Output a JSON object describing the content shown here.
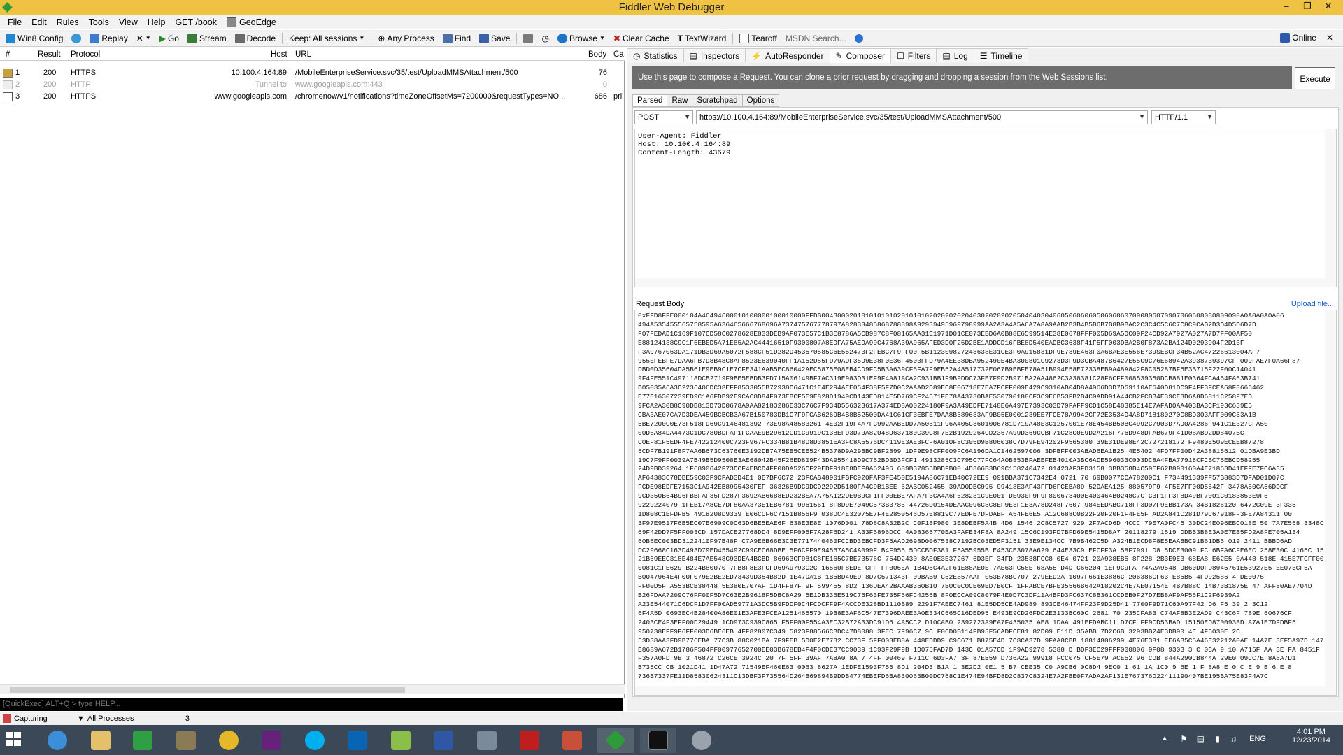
{
  "window": {
    "title": "Fiddler Web Debugger"
  },
  "menu": [
    "File",
    "Edit",
    "Rules",
    "Tools",
    "View",
    "Help",
    "GET /book",
    "GeoEdge"
  ],
  "toolbar": {
    "win8config": "Win8 Config",
    "replay": "Replay",
    "remove": "✕",
    "go": "Go",
    "stream": "Stream",
    "decode": "Decode",
    "keep": "Keep: All sessions",
    "any_process": "Any Process",
    "find": "Find",
    "save": "Save",
    "browse": "Browse",
    "clear_cache": "Clear Cache",
    "textwizard": "TextWizard",
    "tearoff": "Tearoff",
    "msdn_search": "MSDN Search...",
    "online": "Online"
  },
  "sessions": {
    "columns": [
      "#",
      "Result",
      "Protocol",
      "Host",
      "URL",
      "Body",
      "Ca"
    ],
    "rows": [
      {
        "num": "1",
        "result": "200",
        "protocol": "HTTPS",
        "host": "10.100.4.164:89",
        "url": "/MobileEnterpriseService.svc/35/test/UploadMMSAttachment/500",
        "body": "76",
        "ca": "",
        "dim": false
      },
      {
        "num": "2",
        "result": "200",
        "protocol": "HTTP",
        "host": "Tunnel to",
        "url": "www.googleapis.com:443",
        "body": "0",
        "ca": "",
        "dim": true
      },
      {
        "num": "3",
        "result": "200",
        "protocol": "HTTPS",
        "host": "www.googleapis.com",
        "url": "/chromenow/v1/notifications?timeZoneOffsetMs=7200000&requestTypes=NO...",
        "body": "686",
        "ca": "pri",
        "dim": false
      }
    ]
  },
  "quickexec": "[QuickExec] ALT+Q > type HELP...",
  "tabs": [
    "Statistics",
    "Inspectors",
    "AutoResponder",
    "Composer",
    "Filters",
    "Log",
    "Timeline"
  ],
  "composer": {
    "info": "Use this page to compose a Request. You can clone a prior request by dragging and dropping a session from the Web Sessions list.",
    "execute": "Execute",
    "subtabs": [
      "Parsed",
      "Raw",
      "Scratchpad",
      "Options"
    ],
    "method": "POST",
    "url": "https://10.100.4.164:89/MobileEnterpriseService.svc/35/test/UploadMMSAttachment/500",
    "version": "HTTP/1.1",
    "headers": [
      "User-Agent: Fiddler",
      "Host: 10.100.4.164:89",
      "Content-Length: 43679"
    ],
    "request_body_label": "Request Body",
    "upload_file": "Upload file...",
    "request_body": "0xFFD8FFE000104A46494600010100000100010000FFDB004300020101010101020101010202020202040302020202050404030406050606060506060607090806070907060608080809090A0A0A0A0A06\n494A535455565758595A636465666768696A737475767778797A82838485868788898A92939495969798999AA2A3A4A5A6A7A8A9AAB2B3B4B5B6B7B8B9BAC2C3C4C5C6C7C8C9CAD2D3D4D5D6D7D\nF07FEDAD1C169F107CD58C0278628E833DEB9AF073E57C1B3E8786A5CB987C8F08165AA31E1971D01CE073EBD6A0B88E6599514E38E0678FFF005D69A5DC09F24CD92A7927A027A7D7FF00AF50\nE88124138C9C1F5EBED5A71E85A2AC44416510F9300807A8EDFA75AEDA99C4768A39A965AFED3D0F25D2BE1ADDCD16FBE8D540EADBC3638F41F5FF003DBA2B0F873A2BA124D0293904F2D13F\nF3A9767063DA171DB3D69A5072F588CF51D282D453570585C6E552473F2FEBC7F9FF00F5B112309827243638E31CE3F0A915831DF9E739E463F0A6BAE3E556E739SEBCF34B52AC47226613004AF7\n955EFEBFE7DAA6FB7D8B48C8AF8523E639040FF1A152D55FD79ADF35D9E38F0E36F4503FFD79A4EE38DBA952490E4BA300801C9273D3F9D3CBA487B6427E55C9C76E68942A3938739397CFF009FAE7F0A66F87\nDBD0D35604DA5B61E9EB9C1E7CFE341AAB5EC86042AEC5875E08EB4CD9FC5B3A639CF6FA7F9EB52A48517732E067B9EBFE78A51B994E58E72338EB9A48A842F8C05287BF5E3B715F22F00C14041\n9F4FE551C497118DCB2719F9BE5EBDB3FD715A06149BF7AC319E983D31EF9F4A81ACA2C931BB1F9B9DDC73FE7F9D2B971BA2AA4862C3A38381C28F6CFF008539350DCB881E0364FCA464FA63B741\nD05035A6A3C2236406DC38EFF8533055B72938C6471C1E4E294AEE054F38F5F7D0C2AAAD2D89EC8E06718E7EA7FCFF009E429C9310AB04D8A4966D3D7D69110AE640D81DC9F4FF3FCEA68F8666462\nE77E16307239ED9C1A6FDB92E9CAC8D84F073EBCF5E9E828D1949CD143ED814E5D769CF24671FE78A43730BAE530790188CF3C9E6B53FB2B4C9ADD91A44CB2FCBB4E39CE3D6A8D6811C258F7ED\n9FCA2A30B8C90DB813D73D0678A9AA82183286E33C76C7F934D556323617A374ED8A00224180F9A3A49EDFE7148E6A497E7393C03D79FAFF9CD1C58E48385E14E7AFAD0AA403BA3CF193C639E5\nCBA3AE07CA7D3DEA459BCBCB3A67B150783DB1C7F9FCAB6269B4B8B52500DA41C61CF3EBFE7DAA8B689633AF9B05E0001239EE7FCE78A9942CF72E3534D4A8D718180270C8BD303AFF009C53A1B\n5BE7200C0E73F518FD69C9146481392 73E98A48583261 4E02F19F4A7FC992AABEDD7A50511F96A405C3601006781D719A48E3C1257001E78E454BB50BC4992C7903D7AD0A4286F941C1E327CFA50\n00D6A84DA4473C1DC780BDFAF1FCAAE9B29612CD1C9919C138EFD3D79A82048D637180C39C8F7E2B1929264CD2367A99D369CCBF71C28C0E9D2A216F776D948DFAB679F41D08ABD2DD8407BC\nC0EF81F5EDF4FE742212400C723F967FC334B81B48D8D3851EA3FC8A5576DC4119E3AE3FCF6A010F8C305D9B806038C7D79FE94202F9565380 39E31DE98E42C727218172 F9480E509ECEEB87278\n5CDF7B191F8F7AA6B673C63760E3192DB7A75EB5CEE524B5378D9A29BBC9BF2899 1DF9E98CFF009FC6A196DA1C1462597006 3DFBFF003ABAD6EA1B25 4E5402 4FD7FF00D42A38815612 01DBA9E3BD\n19C7F9FF0039A7B49B5D9508E3AE68042B45F26ED809F43DA955418D9C752BD3D3FCF1 4913285C3C795C77FC64A0B853BFAEEFEB4010A3BC6ADE596033C003DC8A4FBA77918CFCBC75EBCD58255\n24D9BD39264 1F6890642F73DCF4EBCD4FF00DA526CF29EDF918E8DEF8A62496 689B37855DBDFB00 4D366B3B69C158240472 01423AF3FD3158 3BB358B4C59EF62B890160A4E71863D41EFFE7FC6A35\nAF64383C78DBE59C03F9CFAD3D4E1 0E7BF6C72 23FCAB48901FBFC920FAF3FE450E5194A86C71EB40C72EE9 091BBA371C7342E4 0721 70 69B0077CCA78209C1 F734491339FF57B883D7DFAD01D07C\nFCDE98EDFE7153C1A942EB8995430FEF 36326B9DC9DCD2292D5180FA4C9B1BEE 62ABC052455 39AD0DBC995 99418E3AF43FFD6FCEBA89 52DAEA125 880579F9 4F5E7FF00D5542F 3478A50CA66DDCF\n9CD350B64B96FBBFAF35FD287F3692AB6688ED232BEA7A75A122DE9B9CF1FF00EBE7AFA7F3CA4A6F628231C9E001 DE930F9F9F800673400E400464B0248C7C C3F1FF3F8D49BF7001C0183853E9F5\n9229224079 1FEB17A8CE7DF80AA373E1EB6781 9961561 8F8D9E7049C573B3785 44726D0154DEAAC096C8C8EF9E3F1E3A78D248F7607 984EEDABC718FF3D07F9EBB173A 34B1826120 6472C09E 3F335\n1D808C1EFDFB5 4918208D9339 E06CCF6C7151B856F9 038DC4E32075E7F4E2850546D57E8819C77EDFE7DFDABF A54FE6E5 A12C688C0B22F20F20F1F4FE5F AD2A841C281D79C67918FF3FE7A84311 00\n3F97E9517F6B5EC07E6909C0C63D6BE5EAE6F 638E3E8E 1076D001 78D8C8A32B2C C0F18F980 3E8DEBF5A4B 4D6 1546 2C8C5727 929 2F7ACD6D 4CCC 79E7A0FC45 30DC24E096EBC018E 50 7A7E558 3348C5\n69F42DD7F5FF003CD 157DACE27768DD4 8D9EFF005F7A28F6D241 A33F6896DCC 4A08365770EA3FAFE34F8A 8A249 15C6C193FD7BFD69E5415D8A7 20118279 1519 DDBB3B8E3A0E7EB5FD2A8FE705A134\n60B6EC003BD3122410F97B48F C7A9E6B66E3C3E7717440460FCCBD3EBCFD3F5AAD2698D0067538C7192BC03ED5F3151 33E9E134CC 7B9B462C5D A324B1ECD8F8E5EAABBC91B61DB6 019 2411 BBBD6AD\nDC29668C163D493D79ED455492C99CEC68DBE 5F6CFF9E94567A5C4A099F B4F955 5DCCBDF381 F5A55955B E453CE3078A629 644E33C9 EFCFF3A 58F7991 D8 5DCE3009 FC 6BFA6CFE6EC 258E30C 4165C 15\n21B69EEC318E484E7AE548C93DEA4BCBD 86963CF981C8FE165C7BE73576C 754D2430 8AE0E3E37267 6D3EF 34FD 23538FCC8 0E4 0721 20A938EB5 8F228 2B3E9E3 68EA8 E62E5 0A448 518E 415E7FCFF009\n0081C1FE629 B224B80070 7FB8F8E3FCFD69A9793C2C 16560F8EDEFCFF FF005EA 1B4D5C4A2F61E88AE0E 7AE63FC58E 68A55 D4D C66204 1EF9C9FA 74A2A9548 DB60D0FD8945761E53927E5 EE073CF5A\nB0047964E4F00F079E2BE2ED73439D354B82D 1E47DA1B 1B5BD49EDF8D7C571343F 09BAB9 C62E857AAF 053B78BC707 279EED2A 1097F661E3886C 206386CF63 E85B5 4FD92586 4FDE0075\nFF00D5F A553BCB38448 5E380E707AF 1D4FF87F 9F 599455 8D2 136DEA42BAAAB360B10 7B0C0C0CE69ED7B0CF 1FFABCE7BFE35566B642A18202C4E7AE07154E 4B7B88C 14B73B1875E 47 AFF80AE7704D\nB26FDAA7209C76FF00F5D7C63E2B9618F5DBC8A29 5E1DB336E519C75F63FE735F66FC4256B 8F0ECCA09C8079F4E0D7C3DF11A4BFD3FC637C8B361CCDEB0F27D7EB8AF9AF56F1C2F6939A2\nA23E544071C6DCF1D7FF00AD59771A3DC5B9FDDF0C4FCDCFF9F4ACCDE328BD1110B89 2291F7AEEC7461 81E5DD5CE4AD989 893CE46474FF23F9D25D41 7700F9D71C60A97F42 D6 F5 39 2 3C12\n6F4A5D 0693EC4B28400A86E01E3AFE3FCEA1251465570 19B8E3AF6C547E7396DAEE3A0E334C665C16DED95 E493E9CD26FDD2E3133BC60C 2681 70 235CFA83 C74AF8B3E2AD9 C43C6F 789E 60676CF\n2403CE4F3EFF00D29449 1CD973C939C865 F5FF00F554A3EC32B72A33DC91D6 4A5CC2 D10CAB0 2392723A9EA7F435035 AE8 1DAA 491EFDABC11 D7CF FF9CD53BAD 15150ED8700938D A7A1E7DFDBF5\n950738EFF9F6FF003D6BE6EB 4FF82807C349 5823F88566CBDC47D8088 3FEC 7F96C7 9C F0CD0B114FB93F56ADFCE81 82D09 E11D 35ABB 7D2C6B 3293BB24E3DB90 4E 4F6030E 2C\n53D38AA3FD9B776EBA 77C3B 88C021BA 7F9FEB 5D0E2E7732 CC73F 5FF003EB8A 448EDDD9 C9C671 B875E4D 7C8CA37D 9FAA8CBB 18814806299 4E76E381 EE6AB5C5A46E32212A0AE 14A7E 3EF5A97D 147E\nE8689A672B1786F504FF00977652700EE03B678EB4F4F0CDE37CC9039 1C93F29F9B 1D075FAD7D 143C 01A57CD 1F9AD9278 5388 D BDF3EC29FFF000806 9F08 9303 3 C 0CA 9 10 A715F AA 3E FA 8451F 3E\nF357A0FD 9B 3 46872 C26CE 3924C 20 7F 5FF 39AF 7A8A0 8A 7 4FF 00469 F711C 6D3FA7 3F 87EB59 D736A22 99918 FCC075 CF5E79 ACE52 96 CDB 844A290CB844A 29E0 09CC7E 8A6A7D1\nB735CC CB 1021D41 1D47A72 71549EF460E63 0063 8627A 1EDFE1593F755 8D1 204D3 B1A 1 3E2D2 0E1 5 B7 CEE35 C0 A9CB6 0C8D4 9EC0 1 61 1A 1C0 9 6E 1 F 8A8 E 0 C E 9 B 6 E 8\n736B7337FE11D85830624311C13DBF3F735564D264B69894B9DDB4774EBEFD6BA830063B00DC768C1E474E94BFD8D2C837C8324E7A2FBE0F7ADA2AF131E767376D22411190407BE195BA75E83F4A7C"
  },
  "status": {
    "capturing": "Capturing",
    "processes": "All Processes",
    "count": "3"
  },
  "taskbar": {
    "lang": "ENG",
    "time": "4:01 PM",
    "date": "12/23/2014"
  },
  "colors": {
    "titlebar": "#f0c243",
    "info_bg": "#6d6d6d",
    "taskbar": "#3a4857",
    "link": "#1a5fd0"
  }
}
